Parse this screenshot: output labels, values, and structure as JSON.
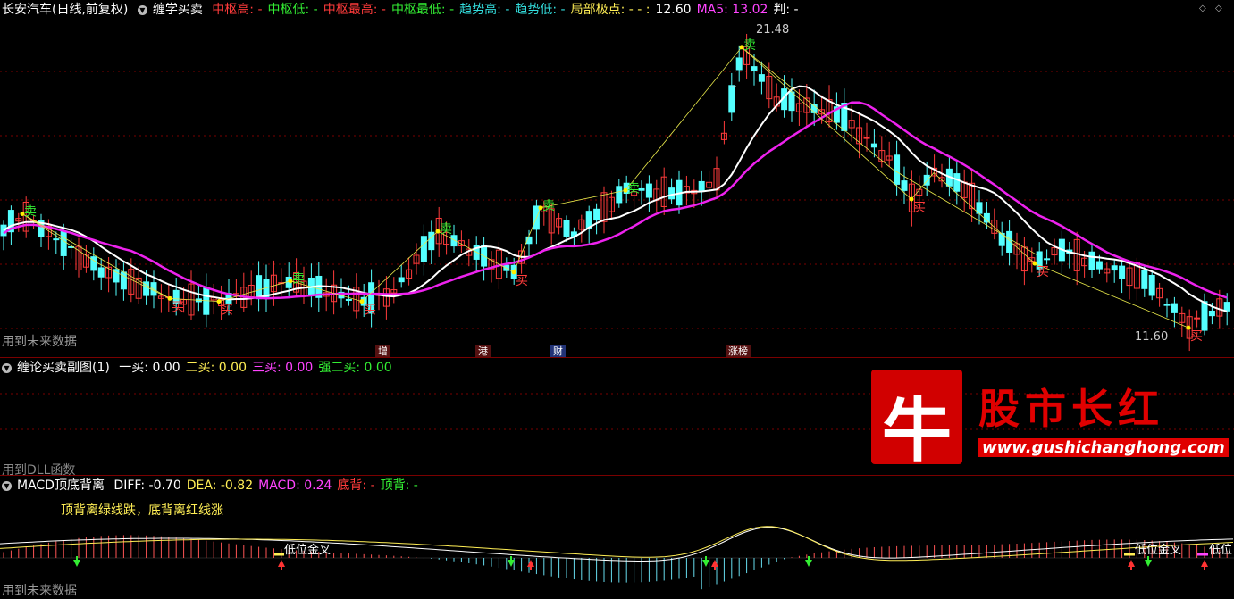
{
  "main": {
    "stock": "长安汽车(日线,前复权)",
    "indicator": "缠学买卖",
    "fields": [
      {
        "label": "中枢高: -",
        "color": "#ff3b3b"
      },
      {
        "label": "中枢低: -",
        "color": "#33ee33"
      },
      {
        "label": "中枢最高: -",
        "color": "#ff3b3b"
      },
      {
        "label": "中枢最低: -",
        "color": "#33ee33"
      },
      {
        "label": "趋势高: -",
        "color": "#33dddd"
      },
      {
        "label": "趋势低: -",
        "color": "#33dddd"
      },
      {
        "label": "局部极点: - - :",
        "color": "#ffee55"
      },
      {
        "label": "12.60",
        "color": "#ffffff"
      },
      {
        "label": "MA5: 13.02",
        "color": "#ff44ff"
      },
      {
        "label": "判: -",
        "color": "#ffffff"
      }
    ],
    "price_high_label": "21.48",
    "price_low_label": "11.60",
    "future_note": "用到未来数据",
    "sell_label": "卖",
    "buy_label": "买",
    "tags": [
      {
        "text": "增",
        "color": "#ff6666"
      },
      {
        "text": "港",
        "color": "#ff6666"
      },
      {
        "text": "财",
        "color": "#66aaff"
      },
      {
        "text": "涨榜",
        "color": "#ff6666"
      }
    ]
  },
  "sub": {
    "title": "缠论买卖副图(1)",
    "fields": [
      {
        "label": "一买: 0.00",
        "color": "#ffffff"
      },
      {
        "label": "二买: 0.00",
        "color": "#ffee55"
      },
      {
        "label": "三买: 0.00",
        "color": "#ff44ff"
      },
      {
        "label": "强二买: 0.00",
        "color": "#33ee33"
      }
    ],
    "dll_note": "用到DLL函数"
  },
  "macd": {
    "title": "MACD顶底背离",
    "fields": [
      {
        "label": "DIFF: -0.70",
        "color": "#ffffff"
      },
      {
        "label": "DEA: -0.82",
        "color": "#ffee55"
      },
      {
        "label": "MACD: 0.24",
        "color": "#ff44ff"
      },
      {
        "label": "底背: -",
        "color": "#ff3b3b"
      },
      {
        "label": "顶背: -",
        "color": "#33ee33"
      }
    ],
    "note": "顶背离绿线跌，底背离红线涨",
    "golden_cross_label": "低位金叉",
    "golden_cross_label_cut": "低位",
    "future_note": "用到未来数据"
  },
  "watermark": {
    "logo_char": "牛",
    "title": "股市长红",
    "url": "www.gushichanghong.com"
  },
  "chart_data": {
    "type": "candlestick",
    "price_ylim": [
      11.0,
      22.0
    ],
    "highest": 21.48,
    "lowest": 11.6,
    "ma5_last": 13.02,
    "close_last": 12.6,
    "macd_diff_last": -0.7,
    "macd_dea_last": -0.82,
    "macd_last": 0.24
  },
  "colors": {
    "up": "#ff3b3b",
    "down": "#54ffff",
    "ma": "#ee22ee",
    "ma2": "#ffffff",
    "zigzag": "#e8e84a",
    "grid": "#7a0000"
  }
}
